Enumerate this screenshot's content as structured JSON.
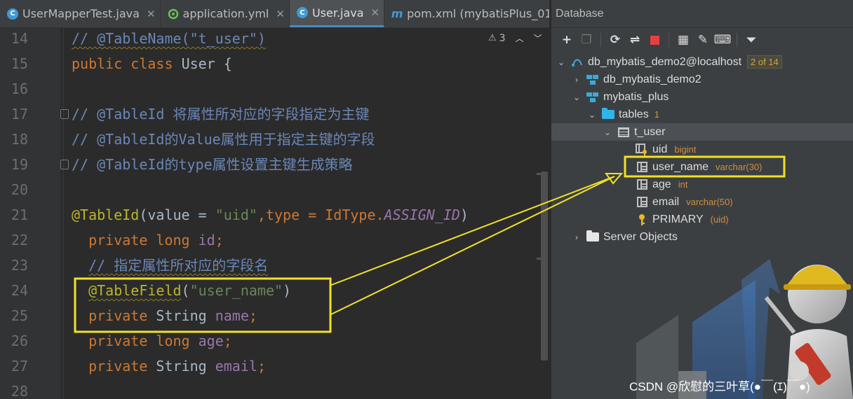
{
  "tabs": [
    {
      "label": "UserMapperTest.java",
      "icon": "class-icon",
      "active": false
    },
    {
      "label": "application.yml",
      "icon": "yml-icon",
      "active": false
    },
    {
      "label": "User.java",
      "icon": "class-icon",
      "active": true
    },
    {
      "label": "pom.xml (mybatisPlus_01_",
      "icon": "maven-icon",
      "active": false
    }
  ],
  "editor": {
    "warnings_count": "3",
    "line_numbers": [
      "14",
      "15",
      "16",
      "17",
      "18",
      "19",
      "20",
      "21",
      "22",
      "23",
      "24",
      "25",
      "26",
      "27",
      "28"
    ],
    "lines": {
      "l14_comment": "// @TableName(\"t_user\")",
      "l15_public": "public",
      "l15_class": "class",
      "l15_name": "User",
      "l15_brace": " {",
      "l17": "// @TableId 将属性所对应的字段指定为主键",
      "l18": "// @TableId的Value属性用于指定主键的字段",
      "l19": "// @TableId的type属性设置主键生成策略",
      "l21_ann": "@TableId",
      "l21_open": "(value = ",
      "l21_str": "\"uid\"",
      "l21_mid": ",type = IdType.",
      "l21_enum": "ASSIGN_ID",
      "l21_close": ")",
      "l22_kw": "private long",
      "l22_field": "id",
      "l22_semi": ";",
      "l23": "// 指定属性所对应的字段名",
      "l24_ann": "@TableField",
      "l24_open": "(",
      "l24_str": "\"user_name\"",
      "l24_close": ")",
      "l25_kw": "private",
      "l25_type": " String ",
      "l25_field": "name",
      "l25_semi": ";",
      "l26_kw": "private long",
      "l26_field": "age",
      "l26_semi": ";",
      "l27_kw": "private",
      "l27_type": " String ",
      "l27_field": "email",
      "l27_semi": ";"
    }
  },
  "database": {
    "title": "Database",
    "toolbar": [
      "add-icon",
      "duplicate-icon",
      "refresh-icon",
      "schema-sync-icon",
      "stop-icon",
      "table-view-icon",
      "edit-icon",
      "console-icon",
      "filter-icon"
    ],
    "tree": {
      "datasource": {
        "label": "db_mybatis_demo2@localhost",
        "badge": "2 of 14"
      },
      "schema1": {
        "label": "db_mybatis_demo2"
      },
      "schema2": {
        "label": "mybatis_plus"
      },
      "tables": {
        "label": "tables",
        "count": "1"
      },
      "table": {
        "label": "t_user"
      },
      "columns": [
        {
          "name": "uid",
          "type": "bigint"
        },
        {
          "name": "user_name",
          "type": "varchar(30)"
        },
        {
          "name": "age",
          "type": "int"
        },
        {
          "name": "email",
          "type": "varchar(50)"
        }
      ],
      "primary": {
        "label": "PRIMARY",
        "detail": "(uid)"
      },
      "server_objects": {
        "label": "Server Objects"
      }
    }
  },
  "watermark": "CSDN @欣慰的三叶草(●￣(ｴ)￣●)",
  "colors": {
    "highlight_box": "#f0e12a",
    "accent": "#4a88c7"
  }
}
